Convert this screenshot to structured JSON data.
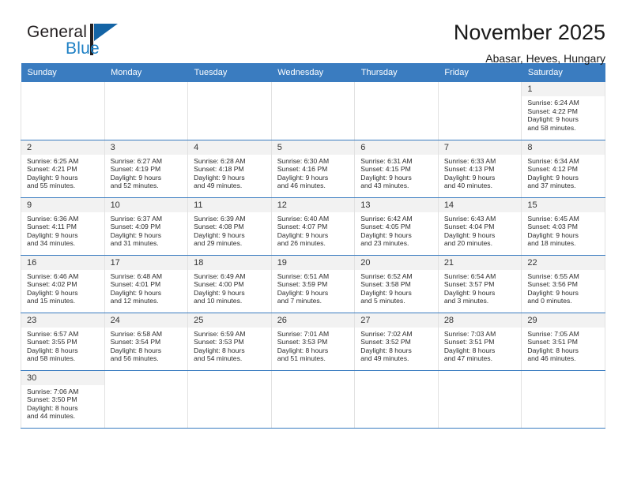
{
  "brand": {
    "name_part1": "General",
    "name_part2": "Blue",
    "logo_icon": "triangle-flag-icon",
    "accent_color": "#1c7fc4"
  },
  "header": {
    "title": "November 2025",
    "subtitle": "Abasar, Heves, Hungary"
  },
  "calendar": {
    "header_bg": "#3a7cc0",
    "daynum_bg": "#f2f2f2",
    "weekdays": [
      "Sunday",
      "Monday",
      "Tuesday",
      "Wednesday",
      "Thursday",
      "Friday",
      "Saturday"
    ],
    "labels": {
      "sunrise": "Sunrise:",
      "sunset": "Sunset:",
      "daylight": "Daylight:"
    },
    "weeks": [
      [
        {
          "day": "",
          "sunrise": "",
          "sunset": "",
          "daylight_line1": "",
          "daylight_line2": ""
        },
        {
          "day": "",
          "sunrise": "",
          "sunset": "",
          "daylight_line1": "",
          "daylight_line2": ""
        },
        {
          "day": "",
          "sunrise": "",
          "sunset": "",
          "daylight_line1": "",
          "daylight_line2": ""
        },
        {
          "day": "",
          "sunrise": "",
          "sunset": "",
          "daylight_line1": "",
          "daylight_line2": ""
        },
        {
          "day": "",
          "sunrise": "",
          "sunset": "",
          "daylight_line1": "",
          "daylight_line2": ""
        },
        {
          "day": "",
          "sunrise": "",
          "sunset": "",
          "daylight_line1": "",
          "daylight_line2": ""
        },
        {
          "day": "1",
          "sunrise": "Sunrise: 6:24 AM",
          "sunset": "Sunset: 4:22 PM",
          "daylight_line1": "Daylight: 9 hours",
          "daylight_line2": "and 58 minutes."
        }
      ],
      [
        {
          "day": "2",
          "sunrise": "Sunrise: 6:25 AM",
          "sunset": "Sunset: 4:21 PM",
          "daylight_line1": "Daylight: 9 hours",
          "daylight_line2": "and 55 minutes."
        },
        {
          "day": "3",
          "sunrise": "Sunrise: 6:27 AM",
          "sunset": "Sunset: 4:19 PM",
          "daylight_line1": "Daylight: 9 hours",
          "daylight_line2": "and 52 minutes."
        },
        {
          "day": "4",
          "sunrise": "Sunrise: 6:28 AM",
          "sunset": "Sunset: 4:18 PM",
          "daylight_line1": "Daylight: 9 hours",
          "daylight_line2": "and 49 minutes."
        },
        {
          "day": "5",
          "sunrise": "Sunrise: 6:30 AM",
          "sunset": "Sunset: 4:16 PM",
          "daylight_line1": "Daylight: 9 hours",
          "daylight_line2": "and 46 minutes."
        },
        {
          "day": "6",
          "sunrise": "Sunrise: 6:31 AM",
          "sunset": "Sunset: 4:15 PM",
          "daylight_line1": "Daylight: 9 hours",
          "daylight_line2": "and 43 minutes."
        },
        {
          "day": "7",
          "sunrise": "Sunrise: 6:33 AM",
          "sunset": "Sunset: 4:13 PM",
          "daylight_line1": "Daylight: 9 hours",
          "daylight_line2": "and 40 minutes."
        },
        {
          "day": "8",
          "sunrise": "Sunrise: 6:34 AM",
          "sunset": "Sunset: 4:12 PM",
          "daylight_line1": "Daylight: 9 hours",
          "daylight_line2": "and 37 minutes."
        }
      ],
      [
        {
          "day": "9",
          "sunrise": "Sunrise: 6:36 AM",
          "sunset": "Sunset: 4:11 PM",
          "daylight_line1": "Daylight: 9 hours",
          "daylight_line2": "and 34 minutes."
        },
        {
          "day": "10",
          "sunrise": "Sunrise: 6:37 AM",
          "sunset": "Sunset: 4:09 PM",
          "daylight_line1": "Daylight: 9 hours",
          "daylight_line2": "and 31 minutes."
        },
        {
          "day": "11",
          "sunrise": "Sunrise: 6:39 AM",
          "sunset": "Sunset: 4:08 PM",
          "daylight_line1": "Daylight: 9 hours",
          "daylight_line2": "and 29 minutes."
        },
        {
          "day": "12",
          "sunrise": "Sunrise: 6:40 AM",
          "sunset": "Sunset: 4:07 PM",
          "daylight_line1": "Daylight: 9 hours",
          "daylight_line2": "and 26 minutes."
        },
        {
          "day": "13",
          "sunrise": "Sunrise: 6:42 AM",
          "sunset": "Sunset: 4:05 PM",
          "daylight_line1": "Daylight: 9 hours",
          "daylight_line2": "and 23 minutes."
        },
        {
          "day": "14",
          "sunrise": "Sunrise: 6:43 AM",
          "sunset": "Sunset: 4:04 PM",
          "daylight_line1": "Daylight: 9 hours",
          "daylight_line2": "and 20 minutes."
        },
        {
          "day": "15",
          "sunrise": "Sunrise: 6:45 AM",
          "sunset": "Sunset: 4:03 PM",
          "daylight_line1": "Daylight: 9 hours",
          "daylight_line2": "and 18 minutes."
        }
      ],
      [
        {
          "day": "16",
          "sunrise": "Sunrise: 6:46 AM",
          "sunset": "Sunset: 4:02 PM",
          "daylight_line1": "Daylight: 9 hours",
          "daylight_line2": "and 15 minutes."
        },
        {
          "day": "17",
          "sunrise": "Sunrise: 6:48 AM",
          "sunset": "Sunset: 4:01 PM",
          "daylight_line1": "Daylight: 9 hours",
          "daylight_line2": "and 12 minutes."
        },
        {
          "day": "18",
          "sunrise": "Sunrise: 6:49 AM",
          "sunset": "Sunset: 4:00 PM",
          "daylight_line1": "Daylight: 9 hours",
          "daylight_line2": "and 10 minutes."
        },
        {
          "day": "19",
          "sunrise": "Sunrise: 6:51 AM",
          "sunset": "Sunset: 3:59 PM",
          "daylight_line1": "Daylight: 9 hours",
          "daylight_line2": "and 7 minutes."
        },
        {
          "day": "20",
          "sunrise": "Sunrise: 6:52 AM",
          "sunset": "Sunset: 3:58 PM",
          "daylight_line1": "Daylight: 9 hours",
          "daylight_line2": "and 5 minutes."
        },
        {
          "day": "21",
          "sunrise": "Sunrise: 6:54 AM",
          "sunset": "Sunset: 3:57 PM",
          "daylight_line1": "Daylight: 9 hours",
          "daylight_line2": "and 3 minutes."
        },
        {
          "day": "22",
          "sunrise": "Sunrise: 6:55 AM",
          "sunset": "Sunset: 3:56 PM",
          "daylight_line1": "Daylight: 9 hours",
          "daylight_line2": "and 0 minutes."
        }
      ],
      [
        {
          "day": "23",
          "sunrise": "Sunrise: 6:57 AM",
          "sunset": "Sunset: 3:55 PM",
          "daylight_line1": "Daylight: 8 hours",
          "daylight_line2": "and 58 minutes."
        },
        {
          "day": "24",
          "sunrise": "Sunrise: 6:58 AM",
          "sunset": "Sunset: 3:54 PM",
          "daylight_line1": "Daylight: 8 hours",
          "daylight_line2": "and 56 minutes."
        },
        {
          "day": "25",
          "sunrise": "Sunrise: 6:59 AM",
          "sunset": "Sunset: 3:53 PM",
          "daylight_line1": "Daylight: 8 hours",
          "daylight_line2": "and 54 minutes."
        },
        {
          "day": "26",
          "sunrise": "Sunrise: 7:01 AM",
          "sunset": "Sunset: 3:53 PM",
          "daylight_line1": "Daylight: 8 hours",
          "daylight_line2": "and 51 minutes."
        },
        {
          "day": "27",
          "sunrise": "Sunrise: 7:02 AM",
          "sunset": "Sunset: 3:52 PM",
          "daylight_line1": "Daylight: 8 hours",
          "daylight_line2": "and 49 minutes."
        },
        {
          "day": "28",
          "sunrise": "Sunrise: 7:03 AM",
          "sunset": "Sunset: 3:51 PM",
          "daylight_line1": "Daylight: 8 hours",
          "daylight_line2": "and 47 minutes."
        },
        {
          "day": "29",
          "sunrise": "Sunrise: 7:05 AM",
          "sunset": "Sunset: 3:51 PM",
          "daylight_line1": "Daylight: 8 hours",
          "daylight_line2": "and 46 minutes."
        }
      ],
      [
        {
          "day": "30",
          "sunrise": "Sunrise: 7:06 AM",
          "sunset": "Sunset: 3:50 PM",
          "daylight_line1": "Daylight: 8 hours",
          "daylight_line2": "and 44 minutes."
        },
        {
          "day": "",
          "sunrise": "",
          "sunset": "",
          "daylight_line1": "",
          "daylight_line2": ""
        },
        {
          "day": "",
          "sunrise": "",
          "sunset": "",
          "daylight_line1": "",
          "daylight_line2": ""
        },
        {
          "day": "",
          "sunrise": "",
          "sunset": "",
          "daylight_line1": "",
          "daylight_line2": ""
        },
        {
          "day": "",
          "sunrise": "",
          "sunset": "",
          "daylight_line1": "",
          "daylight_line2": ""
        },
        {
          "day": "",
          "sunrise": "",
          "sunset": "",
          "daylight_line1": "",
          "daylight_line2": ""
        },
        {
          "day": "",
          "sunrise": "",
          "sunset": "",
          "daylight_line1": "",
          "daylight_line2": ""
        }
      ]
    ]
  }
}
